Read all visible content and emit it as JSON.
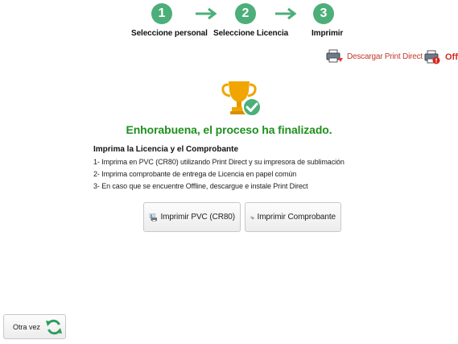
{
  "stepper": {
    "steps": [
      {
        "number": "1",
        "label": "Seleccione personal"
      },
      {
        "number": "2",
        "label": "Seleccione Licencia"
      },
      {
        "number": "3",
        "label": "Imprimir"
      }
    ]
  },
  "print_direct": {
    "download_label": "Descargar Print Direct",
    "status_label": "Off",
    "link_color": "#c0392b",
    "status_color": "#d6261e"
  },
  "result": {
    "title": "Enhorabuena, el proceso ha finalizado.",
    "title_color": "#1f8f1f"
  },
  "instructions": {
    "heading": "Imprima la Licencia y el Comprobante",
    "lines": [
      "1- Imprima en PVC (CR80) utilizando Print Direct y su impresora de sublimación",
      "2- Imprima comprobante de entrega de Licencia en papel común",
      "3- En caso que se encuentre Offline, descargue e instale Print Direct"
    ]
  },
  "actions": {
    "print_pvc_label": "Imprimir PVC (CR80)",
    "print_receipt_label": "Imprimir Comprobante",
    "again_label": "Otra vez"
  },
  "icons": {
    "step_color": "#4caf7a",
    "trophy": "trophy-icon",
    "check": "check-circle-icon",
    "pvc": "id-card-printer-icon",
    "receipt": "document-printer-icon",
    "refresh": "refresh-icon"
  }
}
